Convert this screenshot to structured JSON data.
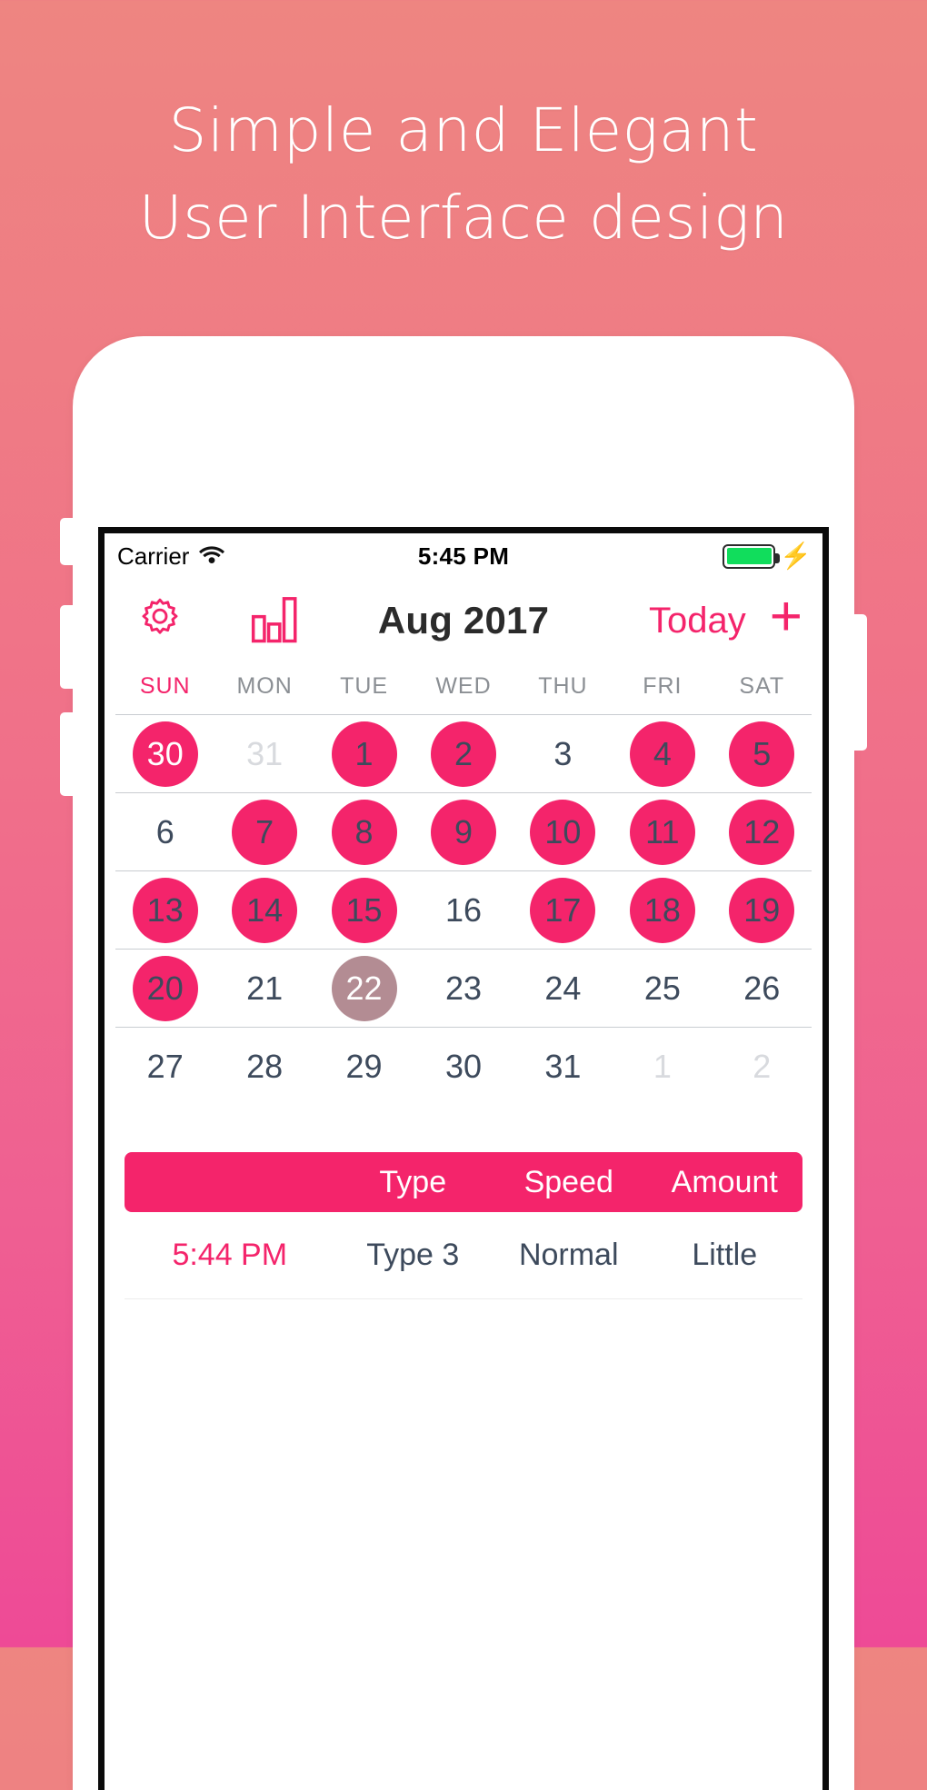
{
  "promo": {
    "line1": "Simple and Elegant",
    "line2": "User Interface design",
    "text_color": "#ffffff",
    "bg_top": "#ee8581",
    "bg_bottom": "#ee4a96"
  },
  "statusbar": {
    "carrier": "Carrier",
    "wifi_icon": "wifi-icon",
    "time": "5:45 PM",
    "battery_icon": "battery-icon",
    "battery_color": "#11dd5c",
    "charging_icon": "lightning-bolt-icon"
  },
  "navbar": {
    "settings_icon": "gear-icon",
    "stats_icon": "bar-chart-icon",
    "title": "Aug 2017",
    "today_label": "Today",
    "add_icon": "plus-icon",
    "accent_color": "#f4246b"
  },
  "calendar": {
    "weekdays": [
      "SUN",
      "MON",
      "TUE",
      "WED",
      "THU",
      "FRI",
      "SAT"
    ],
    "marked_color": "#f4246b",
    "today_color": "#b38c93",
    "rows": [
      [
        {
          "n": "30",
          "state": "out-marked"
        },
        {
          "n": "31",
          "state": "out"
        },
        {
          "n": "1",
          "state": "marked"
        },
        {
          "n": "2",
          "state": "marked"
        },
        {
          "n": "3",
          "state": "plain"
        },
        {
          "n": "4",
          "state": "marked"
        },
        {
          "n": "5",
          "state": "marked"
        }
      ],
      [
        {
          "n": "6",
          "state": "plain"
        },
        {
          "n": "7",
          "state": "marked"
        },
        {
          "n": "8",
          "state": "marked"
        },
        {
          "n": "9",
          "state": "marked"
        },
        {
          "n": "10",
          "state": "marked"
        },
        {
          "n": "11",
          "state": "marked"
        },
        {
          "n": "12",
          "state": "marked"
        }
      ],
      [
        {
          "n": "13",
          "state": "marked"
        },
        {
          "n": "14",
          "state": "marked"
        },
        {
          "n": "15",
          "state": "marked"
        },
        {
          "n": "16",
          "state": "plain"
        },
        {
          "n": "17",
          "state": "marked"
        },
        {
          "n": "18",
          "state": "marked"
        },
        {
          "n": "19",
          "state": "marked"
        }
      ],
      [
        {
          "n": "20",
          "state": "marked"
        },
        {
          "n": "21",
          "state": "plain"
        },
        {
          "n": "22",
          "state": "today"
        },
        {
          "n": "23",
          "state": "plain"
        },
        {
          "n": "24",
          "state": "plain"
        },
        {
          "n": "25",
          "state": "plain"
        },
        {
          "n": "26",
          "state": "plain"
        }
      ],
      [
        {
          "n": "27",
          "state": "plain"
        },
        {
          "n": "28",
          "state": "plain"
        },
        {
          "n": "29",
          "state": "plain"
        },
        {
          "n": "30",
          "state": "plain"
        },
        {
          "n": "31",
          "state": "plain"
        },
        {
          "n": "1",
          "state": "out"
        },
        {
          "n": "2",
          "state": "out"
        }
      ]
    ]
  },
  "entries_table": {
    "headers": [
      "",
      "Type",
      "Speed",
      "Amount"
    ],
    "header_bg": "#f4246b",
    "rows": [
      {
        "time": "5:44 PM",
        "type": "Type 3",
        "speed": "Normal",
        "amount": "Little"
      }
    ]
  }
}
